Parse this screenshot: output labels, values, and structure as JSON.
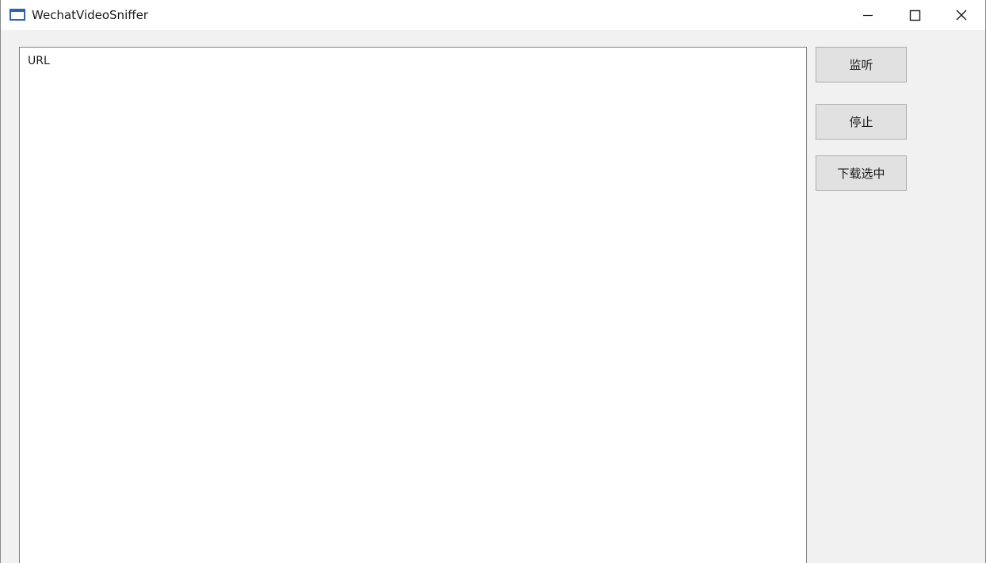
{
  "window": {
    "title": "WechatVideoSniffer"
  },
  "title_controls": {
    "minimize_icon": "minimize-icon",
    "maximize_icon": "maximize-icon",
    "close_icon": "close-icon"
  },
  "list": {
    "column_header": "URL",
    "rows": []
  },
  "buttons": {
    "listen_label": "监听",
    "stop_label": "停止",
    "download_label": "下载选中"
  }
}
